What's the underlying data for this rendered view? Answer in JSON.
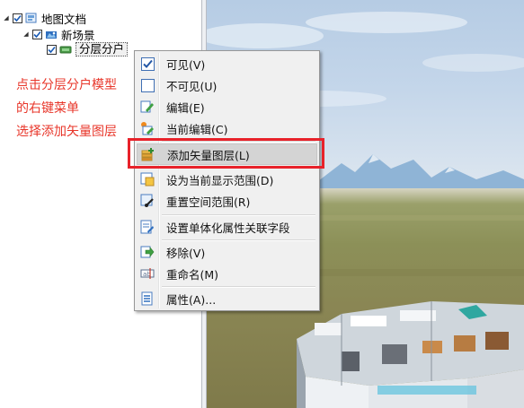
{
  "tree": {
    "root_label": "地图文档",
    "scene_label": "新场景",
    "layer_label": "分层分户"
  },
  "annotation": {
    "line1": "点击分层分户模型",
    "line2": "的右键菜单",
    "line3": "选择添加矢量图层"
  },
  "menu": {
    "items": [
      {
        "label": "可见(V)",
        "icon": "checkbox-checked-icon"
      },
      {
        "label": "不可见(U)",
        "icon": "checkbox-empty-icon"
      },
      {
        "label": "编辑(E)",
        "icon": "edit-icon"
      },
      {
        "label": "当前编辑(C)",
        "icon": "current-edit-icon"
      },
      {
        "label": "添加矢量图层(L)",
        "icon": "add-vector-layer-icon"
      },
      {
        "label": "设为当前显示范围(D)",
        "icon": "set-display-range-icon"
      },
      {
        "label": "重置空间范围(R)",
        "icon": "reset-spatial-range-icon"
      },
      {
        "label": "设置单体化属性关联字段",
        "icon": "set-attribute-field-icon"
      },
      {
        "label": "移除(V)",
        "icon": "remove-icon"
      },
      {
        "label": "重命名(M)",
        "icon": "rename-icon"
      },
      {
        "label": "属性(A)...",
        "icon": "properties-icon"
      }
    ]
  },
  "colors": {
    "annotation": "#e8362a",
    "highlight": "#e8222a",
    "menu_background": "#f0f0f0"
  }
}
